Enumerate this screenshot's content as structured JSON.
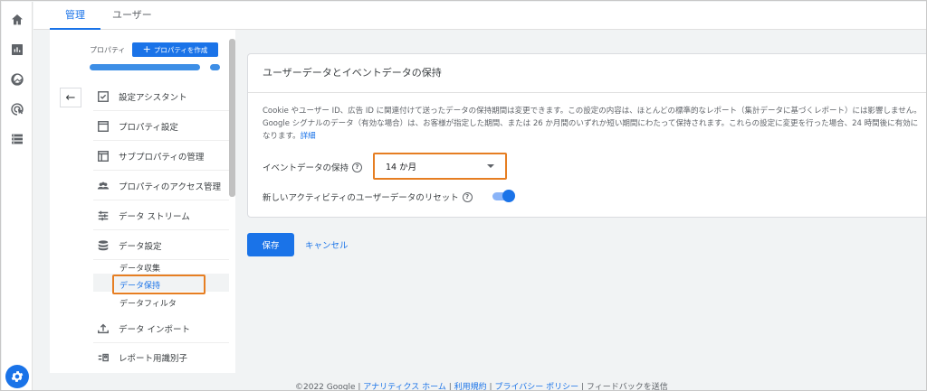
{
  "tabs": {
    "admin": "管理",
    "user": "ユーザー"
  },
  "property": {
    "label": "プロパティ",
    "create_button": "プロパティを作成"
  },
  "nav": [
    {
      "label": "設定アシスタント"
    },
    {
      "label": "プロパティ設定"
    },
    {
      "label": "サブプロパティの管理"
    },
    {
      "label": "プロパティのアクセス管理"
    },
    {
      "label": "データ ストリーム"
    },
    {
      "label": "データ設定"
    }
  ],
  "sub_nav": [
    {
      "label": "データ収集"
    },
    {
      "label": "データ保持"
    },
    {
      "label": "データフィルタ"
    }
  ],
  "nav_lower": [
    {
      "label": "データ インポート"
    },
    {
      "label": "レポート用識別子"
    }
  ],
  "card": {
    "title": "ユーザーデータとイベントデータの保持",
    "description": "Cookie やユーザー ID、広告 ID に関連付けて送ったデータの保持期間は変更できます。この設定の内容は、ほとんどの標準的なレポート（集計データに基づくレポート）には影響しません。Google シグナルのデータ（有効な場合）は、お客様が指定した期間、または 26 か月間のいずれか短い期間にわたって保持されます。これらの設定に変更を行った場合、24 時間後に有効になります。",
    "details_link": "詳細",
    "event_retention_label": "イベントデータの保持",
    "event_retention_value": "14 か月",
    "reset_label": "新しいアクティビティのユーザーデータのリセット"
  },
  "actions": {
    "save": "保存",
    "cancel": "キャンセル"
  },
  "footer": {
    "copyright": "©2022 Google",
    "links": [
      "アナリティクス ホーム",
      "利用規約",
      "プライバシー ポリシー"
    ],
    "feedback": "フィードバックを送信"
  },
  "colors": {
    "accent": "#1a73e8",
    "highlight": "#e67e22"
  }
}
